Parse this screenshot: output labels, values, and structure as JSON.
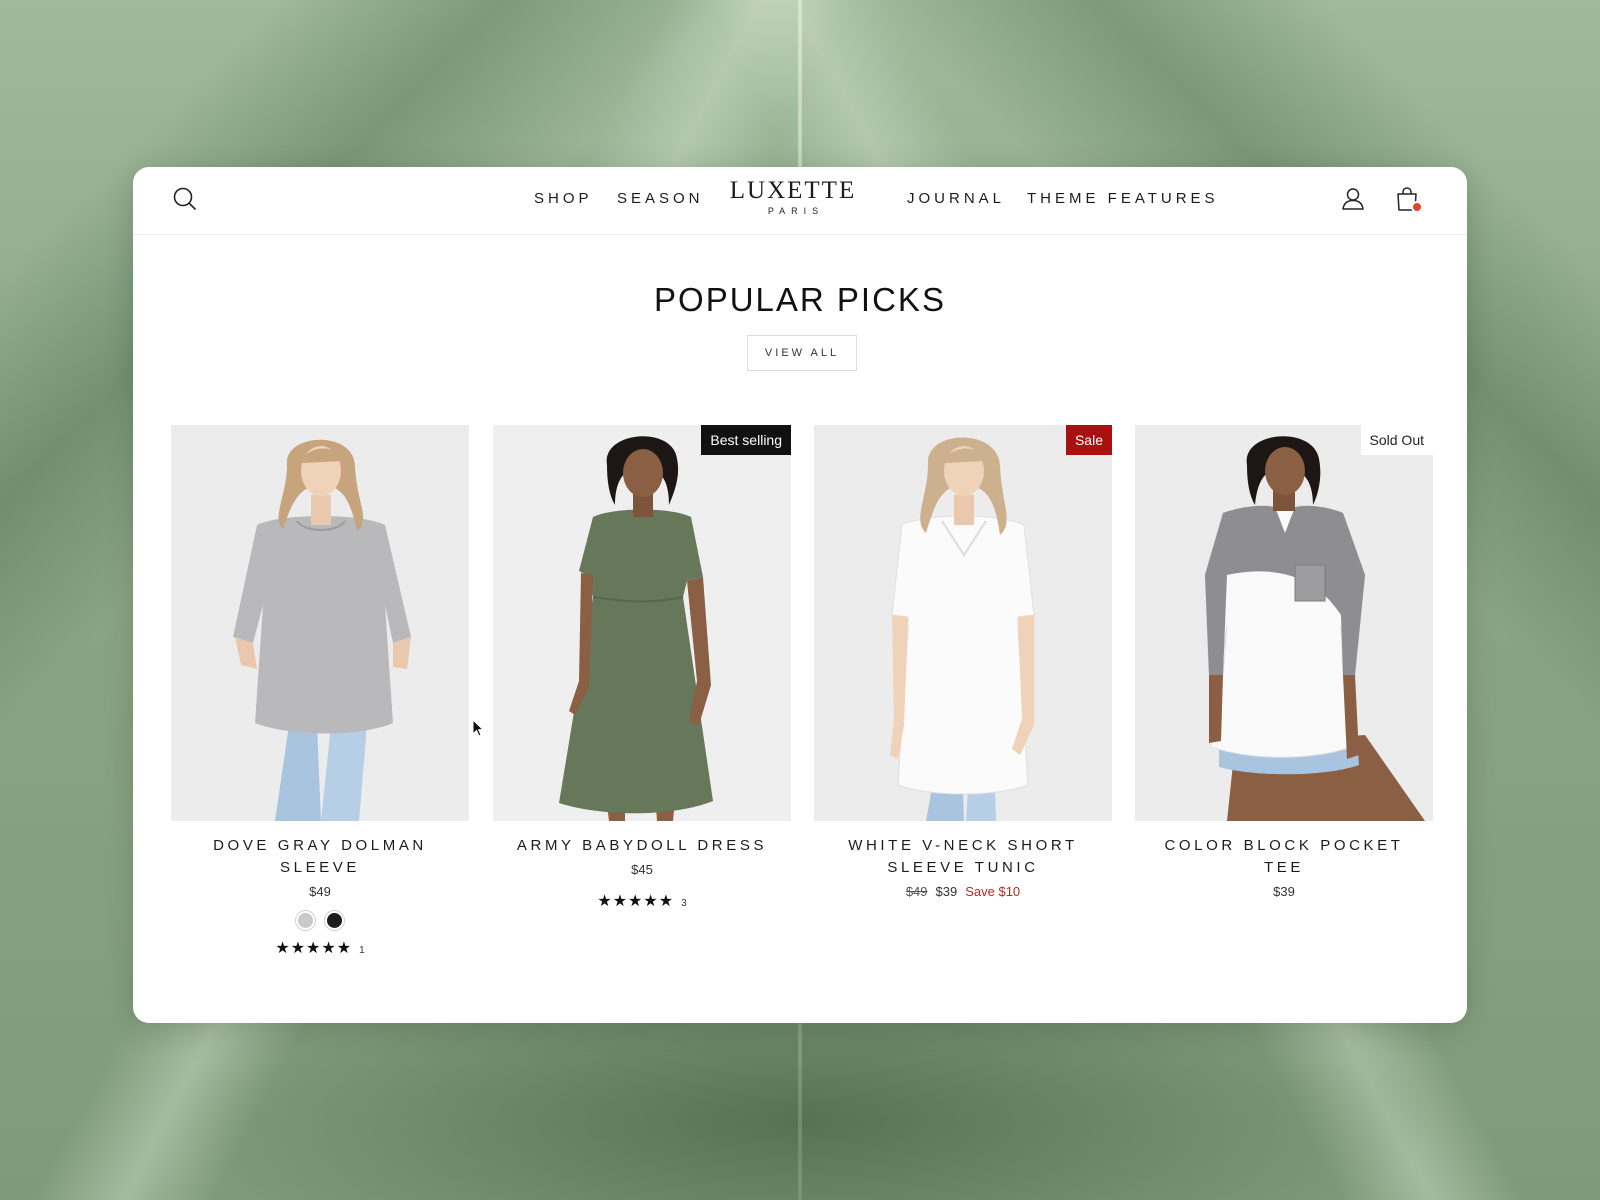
{
  "header": {
    "nav_left": [
      "SHOP",
      "SEASON"
    ],
    "nav_right": [
      "JOURNAL",
      "THEME FEATURES"
    ],
    "logo": {
      "main": "LUXETTE",
      "sub": "PARIS"
    },
    "icons": {
      "search": "search-icon",
      "account": "user-icon",
      "cart": "shopping-bag-icon"
    }
  },
  "section": {
    "title": "POPULAR PICKS",
    "view_all": "VIEW ALL"
  },
  "products": [
    {
      "name": "DOVE GRAY DOLMAN SLEEVE",
      "price": "$49",
      "swatches": [
        "#c9c9c9",
        "#1c1c1c"
      ],
      "stars": "★★★★★",
      "reviews": "1"
    },
    {
      "name": "ARMY BABYDOLL DRESS",
      "price": "$45",
      "badge": "Best selling",
      "stars": "★★★★★",
      "reviews": "3"
    },
    {
      "name": "WHITE V-NECK SHORT SLEEVE TUNIC",
      "compare_price": "$49",
      "price": "$39",
      "save": "Save $10",
      "badge": "Sale"
    },
    {
      "name": "COLOR BLOCK POCKET TEE",
      "price": "$39",
      "badge": "Sold Out"
    }
  ],
  "colors": {
    "cart_dot": "#e0452e",
    "sale_badge": "#a8110f",
    "save_text": "#b02a1e",
    "background_leaf": "#8fa98a"
  }
}
